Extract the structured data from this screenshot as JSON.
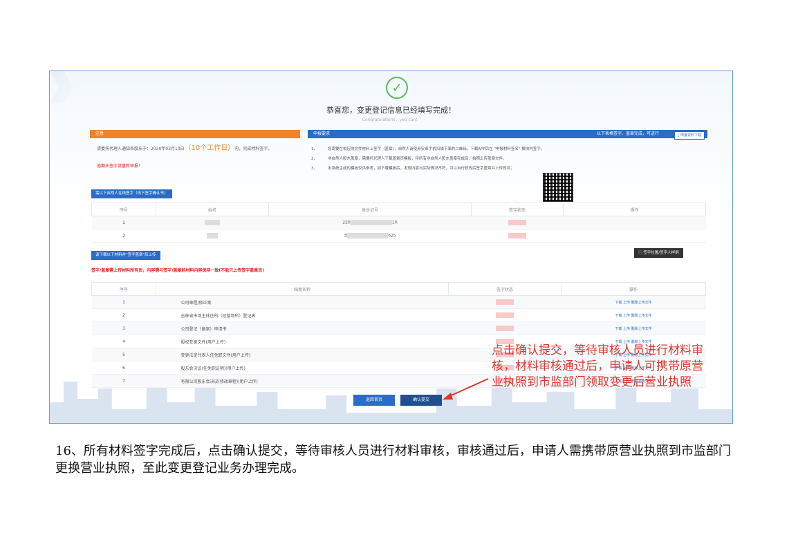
{
  "success": {
    "headline": "恭喜您，变更登记信息已经填写完成！",
    "subline": "Congratulations，you can！"
  },
  "notice": {
    "title": "注意",
    "text_before": "请委托代理人通知各股东于：2020年03月10日",
    "text_highlight": "（10个工作日）",
    "text_after": "内，完成材料签字。",
    "overdue": "逾期未签字请重新申报！"
  },
  "requirements": {
    "title": "申报要求",
    "right_note": "以下表格签字、盖章完成，可进行",
    "download_button": "申报资料下载",
    "items": [
      {
        "num": "1、",
        "text": "您需要在相应的文件材料上签字（盖章），自然人请使用安卓手机扫描下面的二维码，下载APP后在 \"申报材料签名\" 模块内签字。"
      },
      {
        "num": "2、",
        "text": "非自然人股东盖章，需要托代理人下载盖章页模板，待所有非自然人股东盖章完成后，拍照上传盖章文件。"
      },
      {
        "num": "3、",
        "text": "本系统生成的模板仅供参考，如下载模板后，发现内容与实际情况不符，可以自行修改后签字盖章并上传即可。"
      }
    ]
  },
  "persons": {
    "tag": "需以下自然人在线签字（线下签字确认书）",
    "headers": [
      "序号",
      "姓名",
      "身份证号",
      "签字状态",
      "操作"
    ],
    "rows": [
      {
        "no": "1",
        "id_prefix": "220",
        "id_suffix": "1X"
      },
      {
        "no": "2",
        "id_prefix": "3",
        "id_suffix": "625"
      }
    ]
  },
  "materials": {
    "tag": "请下载以下材料并\"签字盖章\"后上传",
    "sample_button": "签字位置/签字人样例",
    "warning": "签字/盖章需上传材料所有页，内容需与签字/盖章前材料内容保持一致(不能只上传签字盖章页)",
    "headers": [
      "序号",
      "档案名称",
      "签字状态",
      "操作"
    ],
    "ops": "下载  上传  删除上传文件",
    "rows": [
      {
        "no": "1",
        "name": "公司章程/修正案"
      },
      {
        "no": "2",
        "name": "吉林省市场主体住所（经营场所）登记表"
      },
      {
        "no": "3",
        "name": "公司登记（备案）申请书"
      },
      {
        "no": "4",
        "name": "股权变更文件(用户上传)"
      },
      {
        "no": "5",
        "name": "变更法定代表人任免职文件(用户上传)"
      },
      {
        "no": "6",
        "name": "股东会决议(任免职证明)(用户上传)"
      },
      {
        "no": "7",
        "name": "有限公司股东会决议(修改章程)(用户上传)"
      }
    ]
  },
  "buttons": {
    "back": "返回首页",
    "submit": "确认提交"
  },
  "annotation": "点击确认提交，等待审核人员进行材料审核，材料审核通过后，申请人可携带原营业执照到市监部门领取变更后营业执照",
  "caption": "16、所有材料签字完成后，点击确认提交，等待审核人员进行材料审核，审核通过后，申请人需携带原营业执照到市监部门更换营业执照，至此变更登记业务办理完成。",
  "colors": {
    "accent_blue": "#2b6cc4",
    "notice_orange": "#f0842c",
    "annotation_red": "#e0342e",
    "success_green": "#5cb85c"
  }
}
